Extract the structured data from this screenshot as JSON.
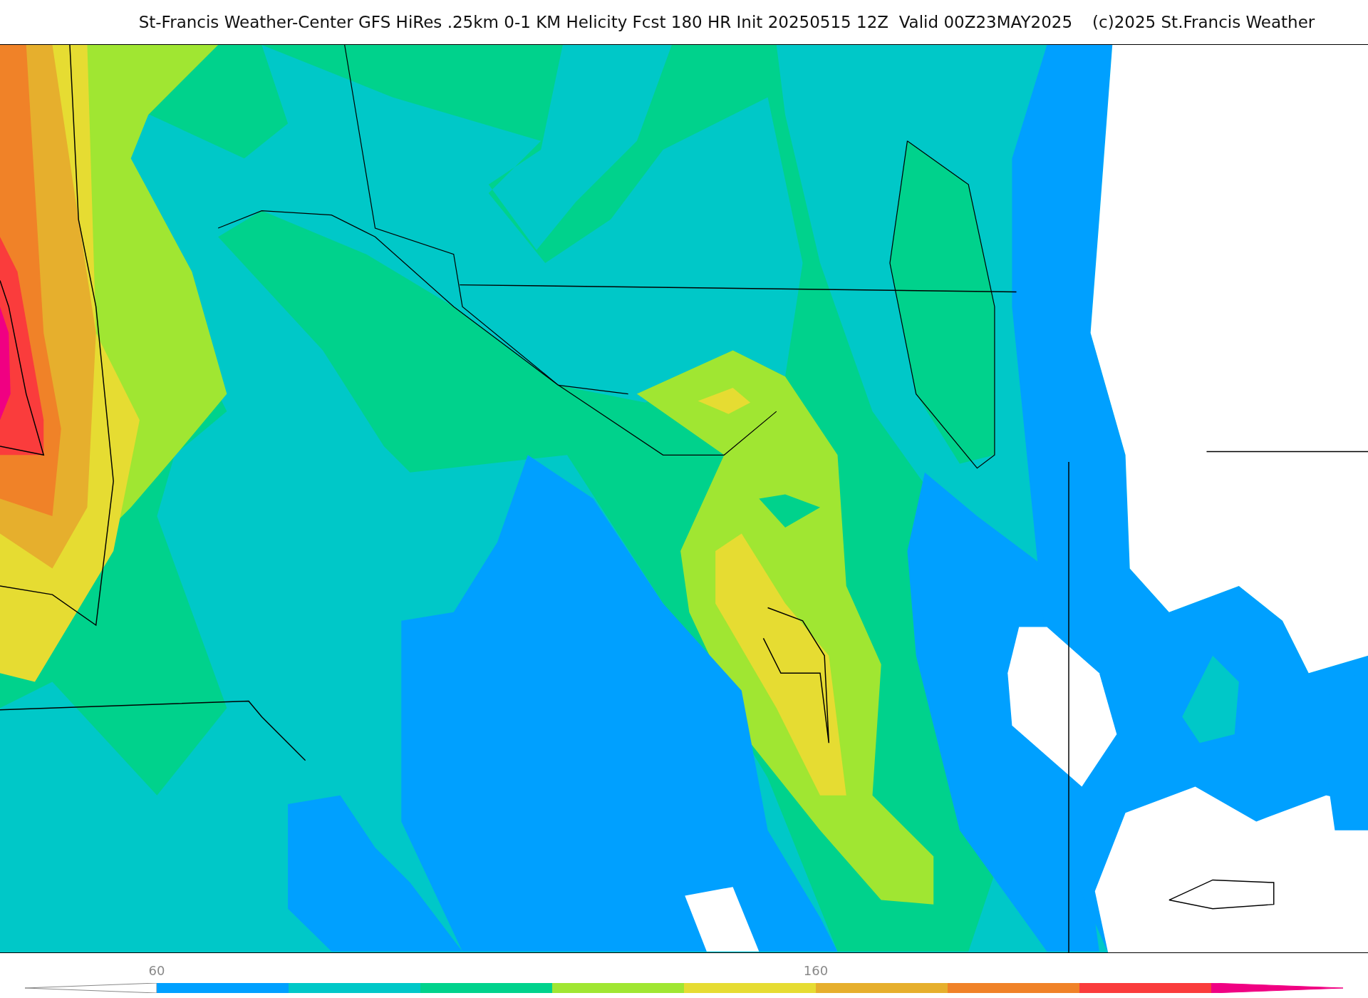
{
  "title": "St-Francis Weather-Center GFS HiRes .25km 0-1 KM Helicity Fcst 180 HR Init 20250515 12Z  Valid 00Z23MAY2025",
  "copyright": "(c)2025 St.Francis Weather",
  "colorbar": {
    "segments": [
      {
        "kind": "arrow"
      },
      {
        "kind": "box",
        "color": "#00a0ff",
        "label": "60"
      },
      {
        "kind": "box",
        "color": "#00c8c8"
      },
      {
        "kind": "box",
        "color": "#00d28c"
      },
      {
        "kind": "box",
        "color": "#a0e632"
      },
      {
        "kind": "box",
        "color": "#e6dc32"
      },
      {
        "kind": "box",
        "color": "#e6af2d",
        "label": "160"
      },
      {
        "kind": "box",
        "color": "#f08228"
      },
      {
        "kind": "box",
        "color": "#fa3c3c"
      },
      {
        "kind": "arrow",
        "color": "#f00082"
      }
    ]
  }
}
